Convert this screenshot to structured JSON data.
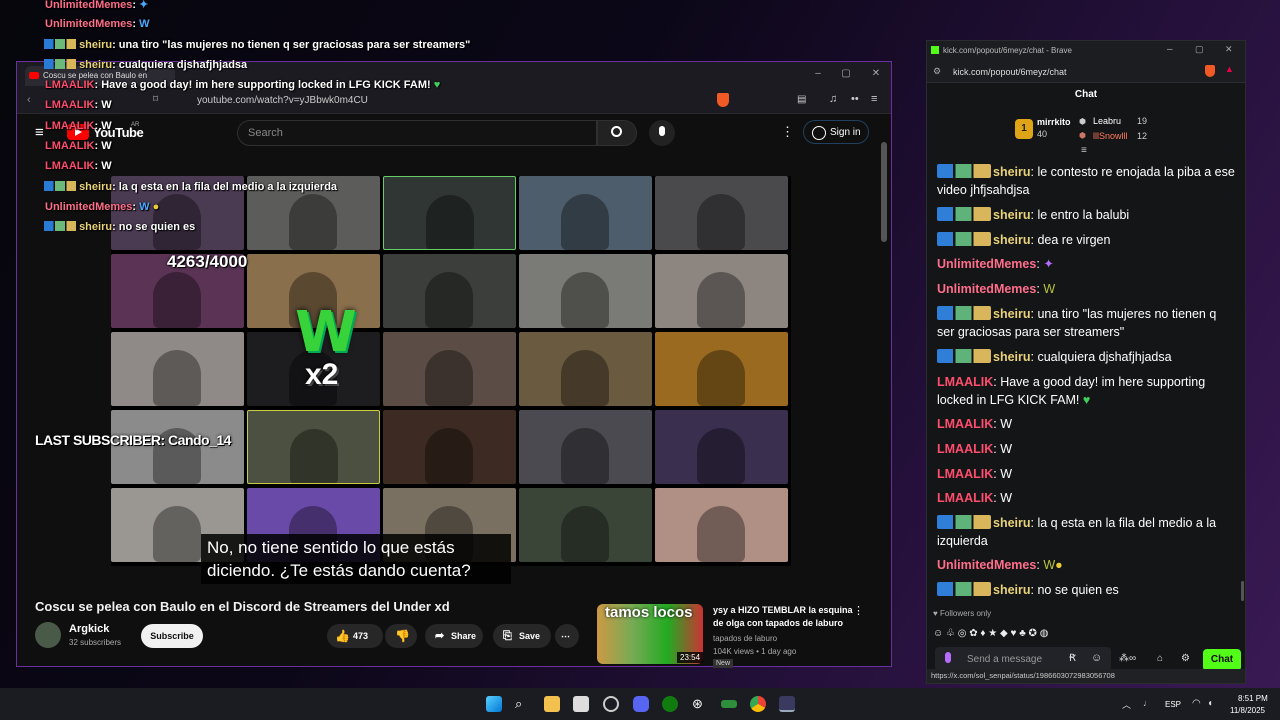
{
  "youtube_window": {
    "tab_title": "Coscu se pelea con Baulo en",
    "url": "youtube.com/watch?v=yJBbwk0m4CU",
    "logo_text": "YouTube",
    "logo_suffix": "AR",
    "search_placeholder": "Search",
    "signin_label": "Sign in",
    "video_overlay": {
      "subscriber_count": "4263/4000",
      "w_text": "W",
      "multiplier": "x2",
      "last_subscriber": "LAST SUBSCRIBER: Cando_14"
    },
    "subtitle_line1": "No, no tiene sentido lo que estás",
    "subtitle_line2": "diciendo. ¿Te estás dando cuenta?",
    "video_title": "Coscu se pelea con Baulo en el Discord de Streamers del Under xd",
    "channel_name": "Argkick",
    "channel_subs": "32 subscribers",
    "subscribe_label": "Subscribe",
    "like_count": "473",
    "share_label": "Share",
    "save_label": "Save",
    "recommended": {
      "thumb_text": "tamos locos",
      "duration": "23:54",
      "title": "ysy a HIZO TEMBLAR la esquina de olga con tapados de laburo",
      "channel": "tapados de laburo",
      "meta": "104K views • 1 day ago",
      "badge": "New"
    }
  },
  "chat_overlay": [
    {
      "user": "UnlimitedMemes",
      "text": ":"
    },
    {
      "user": "UnlimitedMemes",
      "text": ":"
    },
    {
      "user": "sheiru",
      "text": ": una tiro \"las mujeres no tienen q ser graciosas para ser streamers\""
    },
    {
      "user": "sheiru",
      "text": ": cualquiera djshafjhjadsa"
    },
    {
      "user": "LMAALIK",
      "text": ": Have a good day! im here supporting locked in LFG KICK FAM!"
    },
    {
      "user": "LMAALIK",
      "text": ": W"
    },
    {
      "user": "LMAALIK",
      "text": ": W"
    },
    {
      "user": "LMAALIK",
      "text": ": W"
    },
    {
      "user": "LMAALIK",
      "text": ": W"
    },
    {
      "user": "sheiru",
      "text": ": la q esta en la fila del medio a la izquierda"
    },
    {
      "user": "UnlimitedMemes",
      "text": ":"
    },
    {
      "user": "sheiru",
      "text": ": no se quien es"
    }
  ],
  "kick_window": {
    "window_title": "kick.com/popout/6meyz/chat - Brave",
    "url": "kick.com/popout/6meyz/chat",
    "chat_header": "Chat",
    "gifters": [
      {
        "rank": "1",
        "name": "mirrkito",
        "count": "40"
      },
      {
        "rank": "2",
        "name": "Leabru",
        "count": "19"
      },
      {
        "rank": "3",
        "name": "lllSnowlll",
        "count": "12"
      }
    ],
    "messages": [
      {
        "user": "sheiru",
        "text": ": le contesto re enojada la piba a ese video jhfjsahdjsa"
      },
      {
        "user": "sheiru",
        "text": ": le entro la balubi"
      },
      {
        "user": "sheiru",
        "text": ": dea re virgen"
      },
      {
        "user": "UnlimitedMemes",
        "text": ":"
      },
      {
        "user": "UnlimitedMemes",
        "text": ":"
      },
      {
        "user": "sheiru",
        "text": ": una tiro \"las mujeres no tienen q ser graciosas para ser streamers\""
      },
      {
        "user": "sheiru",
        "text": ": cualquiera djshafjhjadsa"
      },
      {
        "user": "LMAALIK",
        "text": ": Have a good day! im here supporting locked in LFG KICK FAM!"
      },
      {
        "user": "LMAALIK",
        "text": ": W"
      },
      {
        "user": "LMAALIK",
        "text": ": W"
      },
      {
        "user": "LMAALIK",
        "text": ": W"
      },
      {
        "user": "LMAALIK",
        "text": ": W"
      },
      {
        "user": "sheiru",
        "text": ": la q esta en la fila del medio a la izquierda"
      },
      {
        "user": "UnlimitedMemes",
        "text": ":"
      },
      {
        "user": "sheiru",
        "text": ": no se quien es"
      }
    ],
    "followers_only": "Followers only",
    "input_placeholder": "Send a message",
    "send_label": "Chat",
    "status_url": "https://x.com/sol_senpai/status/1986603072983056708"
  },
  "taskbar": {
    "language": "ESP",
    "time": "8:51 PM",
    "date": "11/8/2025"
  },
  "colors": {
    "kick_green": "#53fc18",
    "youtube_red": "#ff0000",
    "user_unlimited": "#ff6e8a",
    "user_lmaalik": "#ff4d6d",
    "user_sheiru": "#e8d27a"
  }
}
